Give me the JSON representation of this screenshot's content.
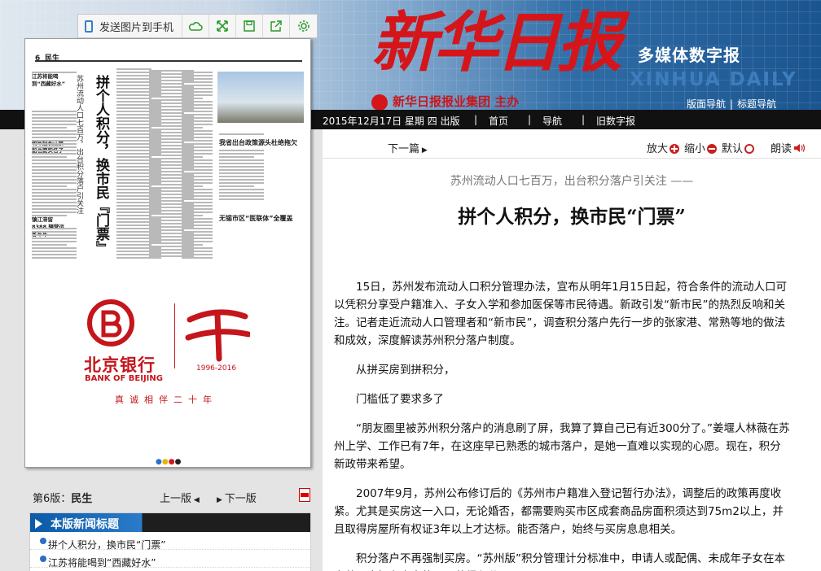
{
  "header": {
    "logo": "新华日报",
    "group": "新华日报报业集团 主办",
    "edition_name": "多媒体数字报",
    "edition_name_en": "XINHUA DAILY",
    "nav": [
      "版面导航",
      "标题导航"
    ],
    "nav_sep": "|"
  },
  "toolbar": {
    "send_label": "发送图片到手机",
    "icons": [
      "cloud-icon",
      "expand-icon",
      "save-icon",
      "share-icon",
      "settings-icon"
    ]
  },
  "navbar": {
    "date": "2015年12月17日 星期 四 出版",
    "items": [
      "首页",
      "导航",
      "旧数字报"
    ],
    "sep": "|"
  },
  "thumbnail": {
    "page_no": "6",
    "page_section": "民生",
    "article_title": "拼个人积分，换市民『门票』",
    "article_subtitle": "苏州流动人口七百万，出台积分落户引关注",
    "side_headlines": [
      "江苏将能喝到“西藏好水”",
      "明年起长江禁船也要实名了",
      "镇江滞留 8388 辆营运客车车"
    ],
    "right_headlines": [
      "我省出台政策源头杜绝拖欠",
      "无锡市区“医联体”全覆盖"
    ],
    "ad": {
      "bank_cn": "北京银行",
      "bank_en": "BANK OF BEIJING",
      "years": "1996-2016",
      "slogan": "真诚相伴二十年"
    }
  },
  "page_nav": {
    "label": "第6版：",
    "section": "民生",
    "prev": "上一版",
    "next": "下一版"
  },
  "news_list": {
    "title": "本版新闻标题",
    "items": [
      "拼个人积分，换市民“门票”",
      "江苏将能喝到“西藏好水”"
    ]
  },
  "article": {
    "next_label": "下一篇",
    "zoom_in": "放大",
    "zoom_out": "缩小",
    "zoom_reset": "默认",
    "read_aloud": "朗读",
    "subtitle": "苏州流动人口七百万，出台积分落户引关注 ——",
    "headline": "拼个人积分，换市民“门票”",
    "paragraphs": [
      "15日，苏州发布流动人口积分管理办法，宣布从明年1月15日起，符合条件的流动人口可以凭积分享受户籍准入、子女入学和参加医保等市民待遇。新政引发“新市民”的热烈反响和关注。记者走近流动人口管理者和“新市民”，调查积分落户先行一步的张家港、常熟等地的做法和成效，深度解读苏州积分落户制度。",
      "从拼买房到拼积分，",
      "门槛低了要求多了",
      "“朋友圈里被苏州积分落户的消息刷了屏，我算了算自己已有近300分了。”姜堰人林薇在苏州上学、工作已有7年，在这座早已熟悉的城市落户，是她一直难以实现的心愿。现在，积分新政带来希望。",
      "2007年9月，苏州公布修订后的《苏州市户籍准入登记暂行办法》，调整后的政策再度收紧。尤其是买房这一入口，无论婚否，都需要购买市区成套商品房面积须达到75m2以上，并且取得房屋所有权证3年以上才达标。能否落户，始终与买房息息相关。",
      "积分落户不再强制买房。“苏州版”积分管理计分标准中，申请人或配偶、未成年子女在本市范围内拥有房产的，可获得积分。"
    ]
  }
}
